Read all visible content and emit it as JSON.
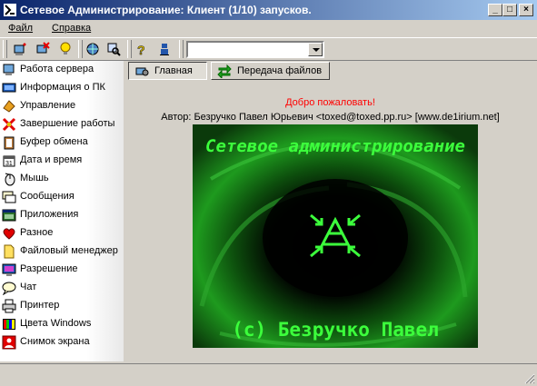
{
  "window": {
    "title": "Сетевое Администрирование: Клиент (1/10) запусков.",
    "minimize_glyph": "_",
    "maximize_glyph": "□",
    "close_glyph": "×"
  },
  "menu": {
    "file": "Файл",
    "help": "Справка"
  },
  "toolbar": {
    "icons": [
      "new-connection-icon",
      "disconnect-icon",
      "idea-icon",
      "network-icon",
      "search-icon",
      "help-icon",
      "user-icon"
    ],
    "combo_value": ""
  },
  "sidebar": {
    "items": [
      {
        "label": "Работа сервера",
        "icon": "server-icon"
      },
      {
        "label": "Информация о ПК",
        "icon": "pc-info-icon"
      },
      {
        "label": "Управление",
        "icon": "control-icon"
      },
      {
        "label": "Завершение работы",
        "icon": "shutdown-icon"
      },
      {
        "label": "Буфер обмена",
        "icon": "clipboard-icon"
      },
      {
        "label": "Дата и время",
        "icon": "datetime-icon"
      },
      {
        "label": "Мышь",
        "icon": "mouse-icon"
      },
      {
        "label": "Сообщения",
        "icon": "messages-icon"
      },
      {
        "label": "Приложения",
        "icon": "applications-icon"
      },
      {
        "label": "Разное",
        "icon": "misc-icon"
      },
      {
        "label": "Файловый менеджер",
        "icon": "file-manager-icon"
      },
      {
        "label": "Разрешение",
        "icon": "resolution-icon"
      },
      {
        "label": "Чат",
        "icon": "chat-icon"
      },
      {
        "label": "Принтер",
        "icon": "printer-icon"
      },
      {
        "label": "Цвета Windows",
        "icon": "colors-icon"
      },
      {
        "label": "Снимок экрана",
        "icon": "screenshot-icon"
      }
    ]
  },
  "tabs": {
    "home": "Главная",
    "transfer": "Передача файлов"
  },
  "main": {
    "welcome": "Добро пожаловать!",
    "author": "Автор: Безручко Павел Юрьевич <toxed@toxed.pp.ru> [www.de1irium.net]",
    "banner_title": "Сетевое администрирование",
    "banner_footer": "(c) Безручко Павел"
  },
  "colors": {
    "titlebar": "#0a246a",
    "welcome": "#ff0000",
    "banner_text": "#3cff3c",
    "banner_bg": "#000000"
  }
}
